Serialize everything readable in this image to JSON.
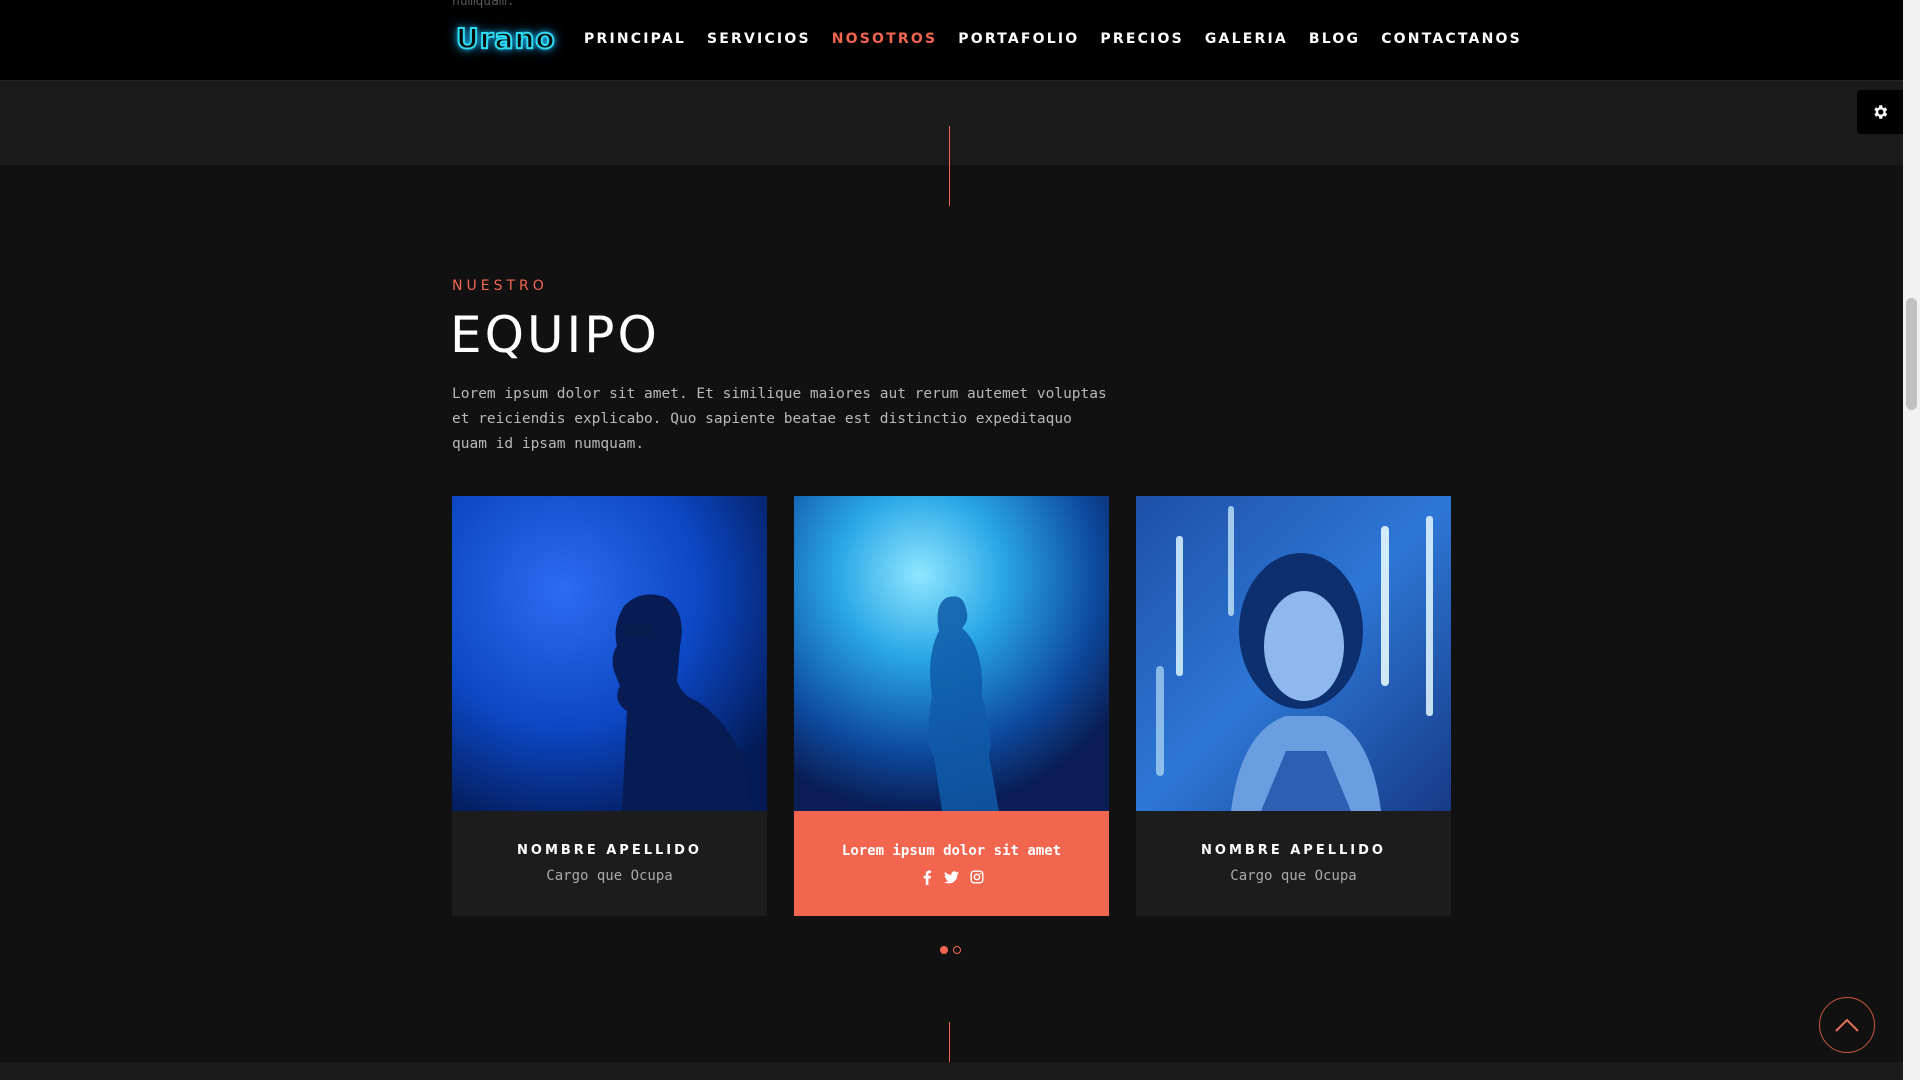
{
  "header": {
    "clipped_text": "numquam.",
    "logo": "Urano",
    "nav": [
      {
        "label": "PRINCIPAL"
      },
      {
        "label": "SERVICIOS"
      },
      {
        "label": "NOSOTROS",
        "active": true
      },
      {
        "label": "PORTAFOLIO"
      },
      {
        "label": "PRECIOS"
      },
      {
        "label": "GALERIA"
      },
      {
        "label": "BLOG"
      },
      {
        "label": "CONTACTANOS"
      }
    ]
  },
  "section": {
    "eyebrow": "NUESTRO",
    "title": "EQUIPO",
    "description": "Lorem ipsum dolor sit amet. Et similique maiores aut rerum autemet voluptas et reiciendis explicabo. Quo sapiente beatae est distinctio expeditaquo quam id ipsam numquam."
  },
  "team": [
    {
      "name": "NOMBRE APELLIDO",
      "role": "Cargo que Ocupa"
    },
    {
      "hover_text": "Lorem ipsum dolor sit amet",
      "socials": [
        "facebook-icon",
        "twitter-icon",
        "instagram-icon"
      ]
    },
    {
      "name": "NOMBRE APELLIDO",
      "role": "Cargo que Ocupa"
    }
  ],
  "carousel": {
    "pages": 2,
    "current": 1
  },
  "colors": {
    "accent": "#f26650",
    "background": "#111111",
    "logo_glow": "#2fd9f0"
  },
  "icons": {
    "settings": "gear-icon",
    "back_to_top": "chevron-up-icon"
  }
}
